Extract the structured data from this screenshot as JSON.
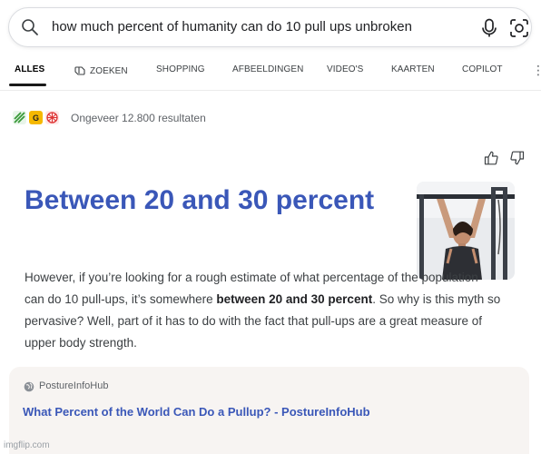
{
  "search": {
    "query": "how much percent of humanity can do 10 pull ups unbroken",
    "icon": "search-icon",
    "mic_icon": "microphone-icon",
    "lens_icon": "visual-search-icon"
  },
  "tabs": [
    {
      "label": "ALLES",
      "active": true
    },
    {
      "label": "ZOEKEN",
      "icon": "copilot-search-icon"
    },
    {
      "label": "SHOPPING"
    },
    {
      "label": "AFBEELDINGEN"
    },
    {
      "label": "VIDEO'S"
    },
    {
      "label": "KAARTEN"
    },
    {
      "label": "COPILOT"
    }
  ],
  "more_menu": "⋮",
  "results_count": "Ongeveer 12.800 resultaten",
  "answer": {
    "title": "Between 20 and 30 percent",
    "body_part1": "However, if you’re looking for a rough estimate of what percentage of the population can do 10 pull-ups, it’s somewhere ",
    "body_bold": "between 20 and 30 percent",
    "body_part2": ". So why is this myth so pervasive? Well, part of it has to do with the fact that pull-ups are a great measure of upper body strength."
  },
  "source": {
    "name": "PostureInfoHub",
    "link": "What Percent of the World Can Do a Pullup? - PostureInfoHub"
  },
  "watermark": "imgflip.com",
  "colors": {
    "accent": "#3a57b8",
    "source_bg": "#f7f4f2"
  }
}
